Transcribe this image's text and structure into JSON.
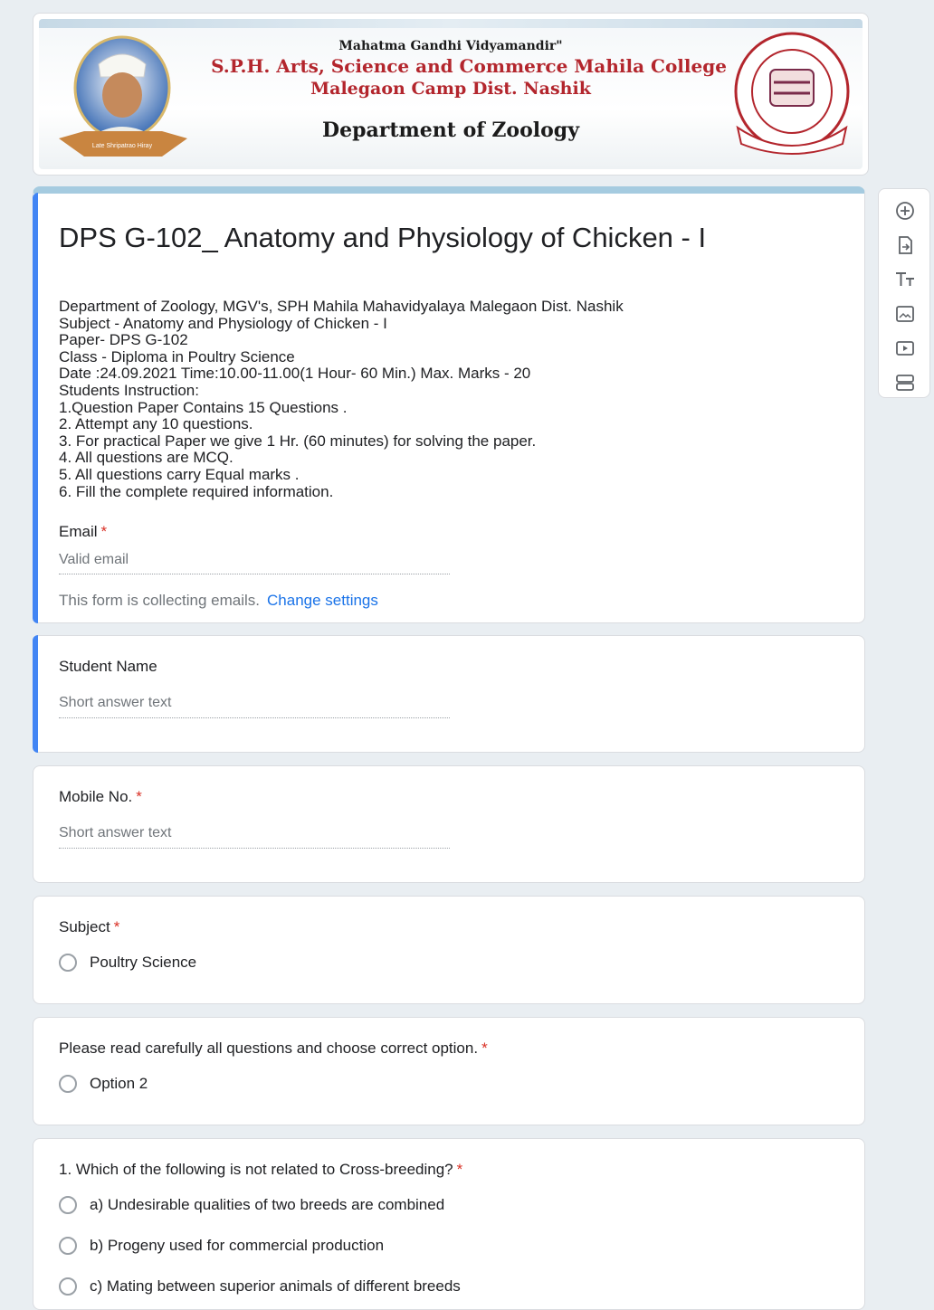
{
  "header": {
    "line1": "Mahatma Gandhi Vidyamandir\"",
    "line2": "S.P.H. Arts, Science and Commerce Mahila College",
    "line3": "Malegaon Camp Dist. Nashik",
    "line4": "Department of Zoology"
  },
  "form": {
    "title": "DPS G-102_ Anatomy and Physiology of Chicken  - I",
    "description": "Department of Zoology, MGV's, SPH Mahila Mahavidyalaya Malegaon Dist. Nashik\nSubject -  Anatomy and Physiology of Chicken  - I\nPaper- DPS G-102\nClass - Diploma in Poultry Science\nDate :24.09.2021  Time:10.00-11.00(1 Hour- 60 Min.)   Max. Marks - 20\n  Students Instruction:\n1.Question Paper Contains 15 Questions .\n2. Attempt any 10  questions.\n3. For practical Paper we give 1 Hr. (60 minutes) for solving the paper.\n4. All questions are MCQ.\n5. All questions carry Equal marks .\n6. Fill the complete required information."
  },
  "email": {
    "label": "Email",
    "placeholder": "Valid email",
    "note": "This form is collecting emails.",
    "link": "Change settings"
  },
  "questions": [
    {
      "label": "Student Name",
      "placeholder": "Short answer text"
    },
    {
      "label": "Mobile No.",
      "placeholder": "Short answer text"
    },
    {
      "label": "Subject",
      "option": "Poultry Science"
    },
    {
      "label": "Please read carefully all questions and choose correct option.",
      "option": "Option 2"
    },
    {
      "label": "1. Which of the following is not related to Cross-breeding?",
      "options": [
        "a) Undesirable qualities of two breeds are combined",
        "b) Progeny used for commercial production",
        "c) Mating between superior animals of different breeds"
      ]
    }
  ],
  "required_mark": "*",
  "toolbar": [
    "add-question-icon",
    "import-questions-icon",
    "add-title-icon",
    "add-image-icon",
    "add-video-icon",
    "add-section-icon"
  ],
  "colors": {
    "accent": "#4285f4",
    "theme": "#a5cbe0",
    "required": "#d93025",
    "link": "#1a73e8"
  }
}
